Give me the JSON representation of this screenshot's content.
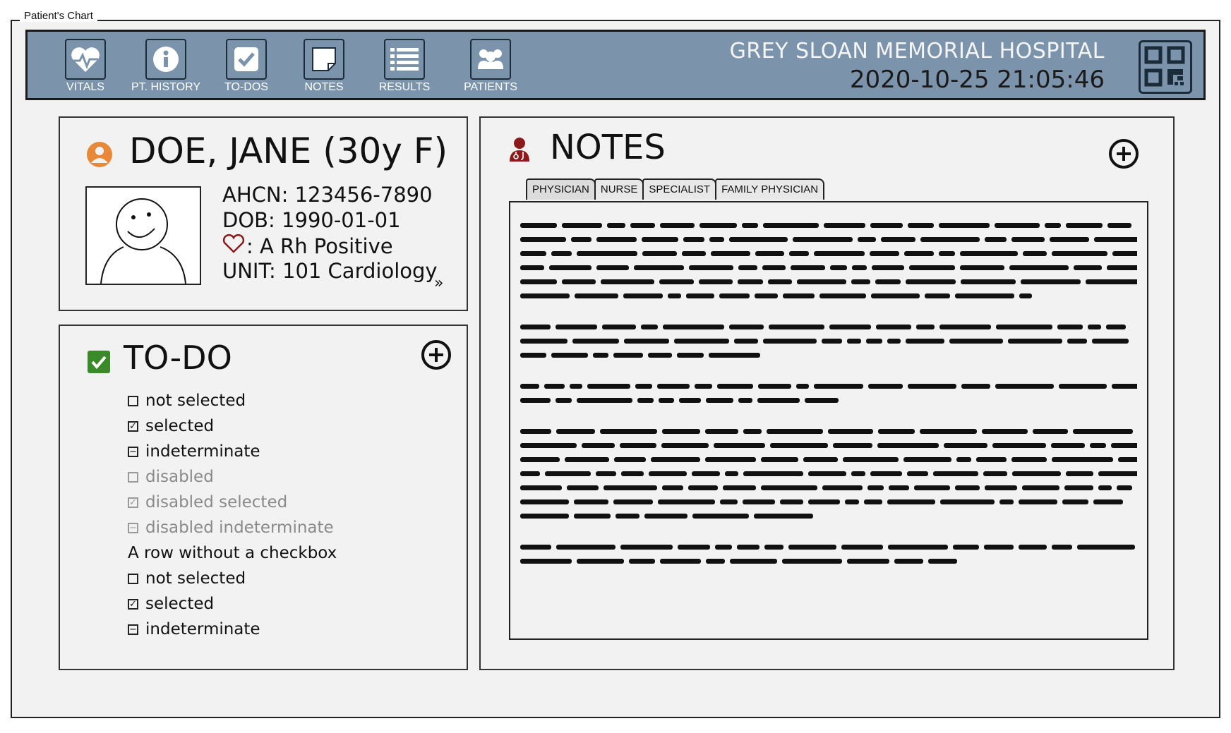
{
  "window": {
    "title": "Patient's Chart"
  },
  "nav": {
    "items": [
      {
        "label": "VITALS",
        "icon": "heartbeat-icon"
      },
      {
        "label": "PT. HISTORY",
        "icon": "info-icon"
      },
      {
        "label": "TO-DOS",
        "icon": "checkbox-icon"
      },
      {
        "label": "NOTES",
        "icon": "note-icon"
      },
      {
        "label": "RESULTS",
        "icon": "list-icon"
      },
      {
        "label": "PATIENTS",
        "icon": "users-icon"
      }
    ]
  },
  "hospital": {
    "name": "GREY SLOAN MEMORIAL HOSPITAL",
    "datetime": "2020-10-25 21:05:46",
    "icon": "qr-code-icon"
  },
  "patient": {
    "name": "DOE, JANE (30y F)",
    "ahcn": "AHCN: 123456-7890",
    "dob": "DOB: 1990-01-01",
    "blood_type": ": A Rh Positive",
    "unit": "UNIT: 101 Cardiology",
    "icon_color": "#e8893a",
    "heart_color": "#8b1a1a"
  },
  "todo": {
    "title": "TO-DO",
    "check_color": "#3a8a2a",
    "items": [
      {
        "label": "not selected",
        "state": "unchecked",
        "disabled": false
      },
      {
        "label": "selected",
        "state": "checked",
        "disabled": false
      },
      {
        "label": "indeterminate",
        "state": "indeterminate",
        "disabled": false
      },
      {
        "label": "disabled",
        "state": "unchecked",
        "disabled": true
      },
      {
        "label": "disabled selected",
        "state": "checked",
        "disabled": true
      },
      {
        "label": "disabled indeterminate",
        "state": "indeterminate",
        "disabled": true
      },
      {
        "label": "A row without a checkbox",
        "state": "none",
        "disabled": false
      },
      {
        "label": "not selected",
        "state": "unchecked",
        "disabled": false
      },
      {
        "label": "selected",
        "state": "checked",
        "disabled": false
      },
      {
        "label": "indeterminate",
        "state": "indeterminate",
        "disabled": false
      }
    ]
  },
  "notes": {
    "title": "NOTES",
    "icon_color": "#8b1a1a",
    "tabs": [
      "PHYSICIAN",
      "NURSE",
      "SPECIALIST",
      "FAMILY PHYSICIAN"
    ],
    "active_tab": "PHYSICIAN"
  }
}
